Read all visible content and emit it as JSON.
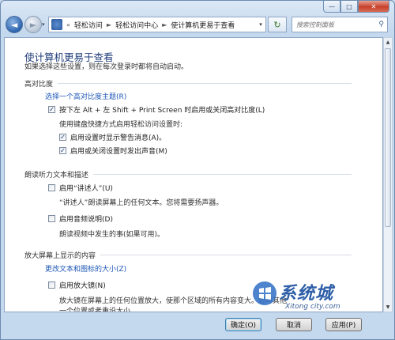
{
  "caption": {
    "minimize": "—",
    "maximize": "□",
    "close": "✕"
  },
  "nav": {
    "back_icon": "◄",
    "forward_icon": "►",
    "dropdown_icon": "▾",
    "breadcrumb_prefix": "«",
    "breadcrumb": [
      "轻松访问",
      "轻松访问中心",
      "使计算机更易于查看"
    ],
    "breadcrumb_sep": "►",
    "address_dropdown_icon": "▾",
    "refresh_icon": "↻",
    "search_placeholder": "搜索控制面板",
    "search_icon": "⚲"
  },
  "page": {
    "title": "使计算机更易于查看",
    "subtitle": "如果选择这些设置，则在每次登录时都将自动启动。"
  },
  "high_contrast": {
    "heading": "高对比度",
    "choose_theme_link": "选择一个高对比度主题(R)",
    "toggle_shortcut": {
      "label": "按下左 Alt + 左 Shift + Print Screen 时启用或关闭高对比度(L)",
      "checked": true
    },
    "shortcut_note": "使用键盘快捷方式启用轻松访问设置时:",
    "warn_message": {
      "label": "启用设置时显示警告消息(A)。",
      "checked": true
    },
    "sound": {
      "label": "启用或关闭设置时发出声音(M)",
      "checked": true
    }
  },
  "narration": {
    "heading": "朗读听力文本和描述",
    "narrator": {
      "label": "启用“讲述人”(U)",
      "checked": false
    },
    "narrator_desc": "“讲述人”朗读屏幕上的任何文本。您将需要扬声器。",
    "audio_desc": {
      "label": "启用音频说明(D)",
      "checked": false
    },
    "audio_desc_note": "朗读视频中发生的事(如果可用)。"
  },
  "magnify": {
    "heading": "放大屏幕上显示的内容",
    "text_size_link": "更改文本和图标的大小(Z)",
    "magnifier": {
      "label": "启用放大镜(N)",
      "checked": false
    },
    "magnifier_desc_1": "放大镜在屏幕上的任何位置放大，使那个区域的所有内容变大。您可",
    "magnifier_desc_1b": "其他",
    "magnifier_desc_2": "一个位置或者重设大小。"
  },
  "buttons": {
    "ok": "确定(O)",
    "cancel": "取消",
    "apply": "应用(P)"
  },
  "scrollbar": {
    "up_icon": "▲",
    "down_icon": "▼"
  },
  "watermark": {
    "brand": "系统城",
    "url": "Xitong city.com"
  },
  "colors": {
    "link": "#1f58b8",
    "title": "#1f3c79",
    "close": "#c7412b"
  }
}
